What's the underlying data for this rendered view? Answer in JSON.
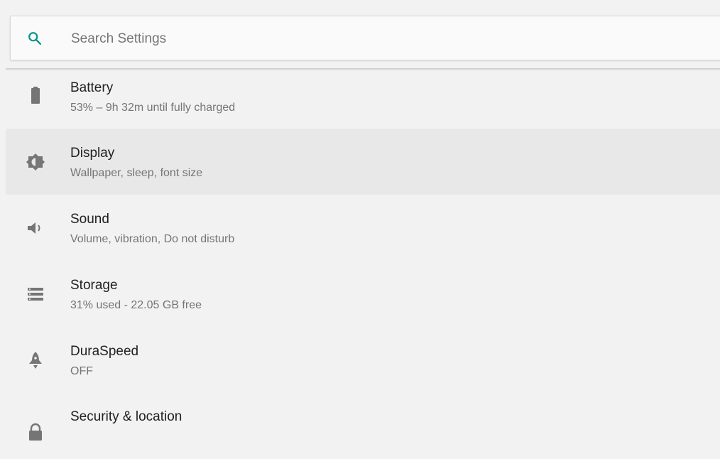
{
  "search": {
    "placeholder": "Search Settings",
    "icon": "search-icon",
    "accent_color": "#009688"
  },
  "settings_items": [
    {
      "id": "battery",
      "title": "Battery",
      "subtitle": "53% – 9h 32m until fully charged",
      "icon": "battery-icon"
    },
    {
      "id": "display",
      "title": "Display",
      "subtitle": "Wallpaper, sleep, font size",
      "icon": "brightness-icon",
      "selected": true
    },
    {
      "id": "sound",
      "title": "Sound",
      "subtitle": "Volume, vibration, Do not disturb",
      "icon": "volume-icon"
    },
    {
      "id": "storage",
      "title": "Storage",
      "subtitle": "31% used - 22.05 GB free",
      "icon": "storage-icon"
    },
    {
      "id": "duraspeed",
      "title": "DuraSpeed",
      "subtitle": "OFF",
      "icon": "rocket-icon"
    },
    {
      "id": "security",
      "title": "Security & location",
      "subtitle": "",
      "icon": "lock-icon"
    }
  ],
  "colors": {
    "background": "#f2f2f2",
    "selected_row": "#e8e8e8",
    "icon_gray": "#757575",
    "title_text": "#212121",
    "subtitle_text": "#757575"
  }
}
